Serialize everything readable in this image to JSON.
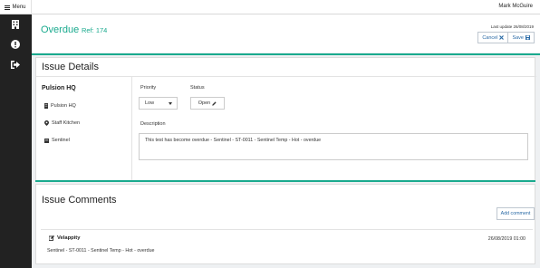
{
  "topbar": {
    "menu_label": "Menu",
    "user_name": "Mark McGuire"
  },
  "sidebar": {
    "items": [
      {
        "icon": "building-icon"
      },
      {
        "icon": "alert-circle-icon"
      },
      {
        "icon": "sign-out-icon"
      }
    ]
  },
  "header": {
    "title": "Overdue",
    "ref": "Ref: 174",
    "last_update": "Last update 26/08/2019",
    "cancel_label": "Cancel",
    "save_label": "Save"
  },
  "issue_details": {
    "title": "Issue Details",
    "location_name": "Pulsion HQ",
    "building": "Pulsion HQ",
    "room": "Staff Kitchen",
    "device": "Sentinel",
    "priority_label": "Priority",
    "priority_value": "Low",
    "status_label": "Status",
    "status_value": "Open",
    "description_label": "Description",
    "description_value": "This test has become overdue - Sentinel - ST-0011 - Sentinel Temp - Hot - overdue"
  },
  "issue_comments": {
    "title": "Issue Comments",
    "add_label": "Add comment",
    "comments": [
      {
        "author": "Velappity",
        "date": "26/08/2019 01:00",
        "text": "Sentinel - ST-0011 - Sentinel Temp - Hot - overdue"
      }
    ]
  },
  "colors": {
    "accent": "#1aaa8e",
    "sidebar": "#222222",
    "link": "#2a6aa6"
  }
}
